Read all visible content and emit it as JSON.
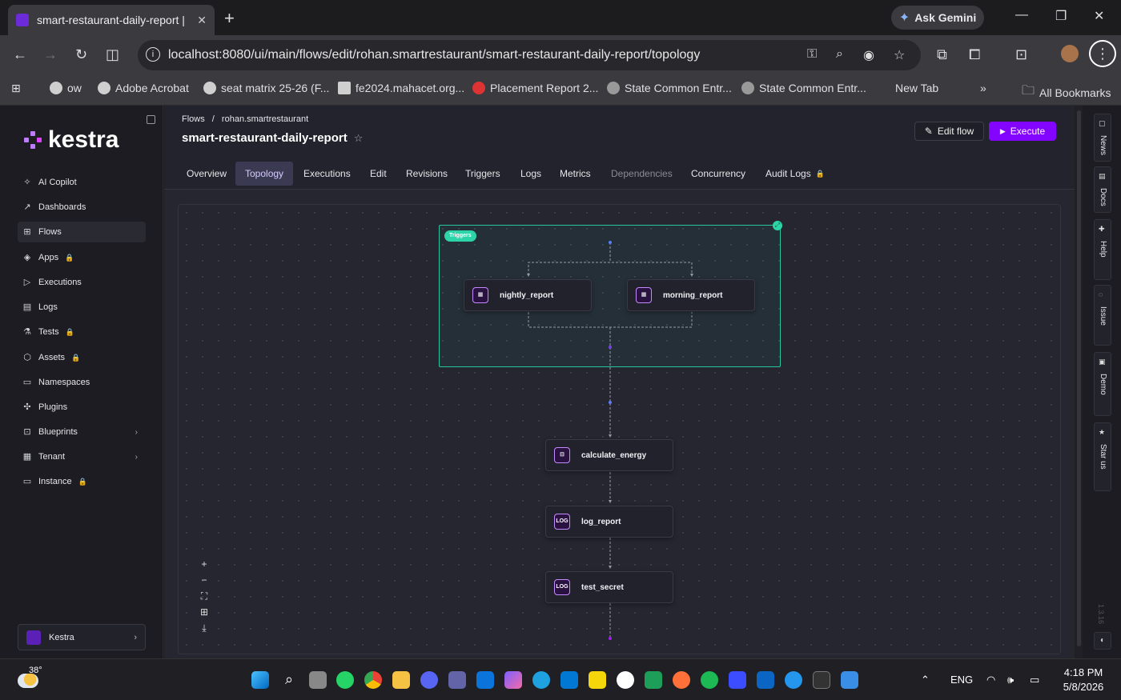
{
  "browser": {
    "tab_title": "smart-restaurant-daily-report |",
    "tab_close": "✕",
    "new_tab": "+",
    "ask_gemini": "Ask Gemini",
    "url": "localhost:8080/ui/main/flows/edit/rohan.smartrestaurant/smart-restaurant-daily-report/topology",
    "bookmarks": [
      {
        "label": "ow"
      },
      {
        "label": "Adobe Acrobat"
      },
      {
        "label": "seat matrix 25-26 (F..."
      },
      {
        "label": "fe2024.mahacet.org..."
      },
      {
        "label": "Placement Report 2..."
      },
      {
        "label": "State Common Entr..."
      },
      {
        "label": "State Common Entr..."
      },
      {
        "label": "New Tab"
      }
    ],
    "more_bookmarks": "»",
    "all_bookmarks": "All Bookmarks"
  },
  "sidebar": {
    "brand": "kestra",
    "items": [
      {
        "label": "AI Copilot",
        "icon": "✧"
      },
      {
        "label": "Dashboards",
        "icon": "↗"
      },
      {
        "label": "Flows",
        "icon": "⊞"
      },
      {
        "label": "Apps",
        "icon": "◈",
        "lock": "🔒"
      },
      {
        "label": "Executions",
        "icon": "▷"
      },
      {
        "label": "Logs",
        "icon": "▤"
      },
      {
        "label": "Tests",
        "icon": "⚗",
        "lock": "🔒"
      },
      {
        "label": "Assets",
        "icon": "⬡",
        "lock": "🔒"
      },
      {
        "label": "Namespaces",
        "icon": "▭"
      },
      {
        "label": "Plugins",
        "icon": "✣"
      },
      {
        "label": "Blueprints",
        "icon": "⊡",
        "chev": "›"
      },
      {
        "label": "Tenant",
        "icon": "▦",
        "chev": "›"
      },
      {
        "label": "Instance",
        "icon": "▭",
        "lock": "🔒"
      }
    ],
    "tenant_card": "Kestra"
  },
  "header": {
    "breadcrumb_root": "Flows",
    "breadcrumb_sep": "/",
    "breadcrumb_ns": "rohan.smartrestaurant",
    "title": "smart-restaurant-daily-report",
    "star": "☆",
    "edit_flow": "Edit flow",
    "execute": "Execute"
  },
  "tabs": [
    {
      "label": "Overview"
    },
    {
      "label": "Topology"
    },
    {
      "label": "Executions"
    },
    {
      "label": "Edit"
    },
    {
      "label": "Revisions"
    },
    {
      "label": "Triggers"
    },
    {
      "label": "Logs"
    },
    {
      "label": "Metrics"
    },
    {
      "label": "Dependencies"
    },
    {
      "label": "Concurrency"
    },
    {
      "label": "Audit Logs"
    }
  ],
  "topology": {
    "trigger_group_label": "Triggers",
    "triggers": [
      {
        "name": "nightly_report"
      },
      {
        "name": "morning_report"
      }
    ],
    "tasks": [
      {
        "name": "calculate_energy"
      },
      {
        "name": "log_report",
        "icon_text": "LOG"
      },
      {
        "name": "test_secret",
        "icon_text": "LOG"
      }
    ],
    "zoom_controls": [
      "+",
      "−",
      "⛶",
      "⊞",
      "⤓"
    ]
  },
  "right_rail": [
    {
      "label": "News"
    },
    {
      "label": "Docs"
    },
    {
      "label": "Help"
    },
    {
      "label": "Issue"
    },
    {
      "label": "Demo"
    },
    {
      "label": "Star us"
    }
  ],
  "version": "1.3.16",
  "taskbar": {
    "temperature": "38°",
    "language": "ENG",
    "time": "4:18 PM",
    "date": "5/8/2026"
  }
}
